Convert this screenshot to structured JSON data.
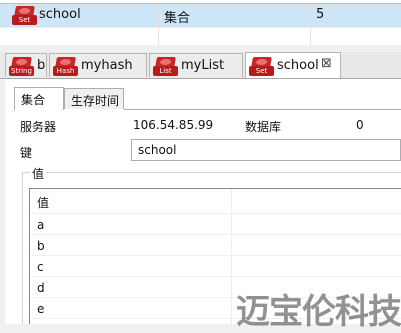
{
  "keys_table": {
    "row": {
      "type_tag": "Set",
      "name": "school",
      "type": "集合",
      "count": "5"
    }
  },
  "tabs": [
    {
      "type_tag": "String",
      "label": "b",
      "active": false
    },
    {
      "type_tag": "Hash",
      "label": "myhash",
      "active": false
    },
    {
      "type_tag": "List",
      "label": "myList",
      "active": false
    },
    {
      "type_tag": "Set",
      "label": "school",
      "active": true
    }
  ],
  "subtabs": [
    "集合",
    "生存时间"
  ],
  "info": {
    "server_label": "服务器",
    "server_value": "106.54.85.99",
    "db_label": "数据库",
    "db_value": "0",
    "key_label": "键",
    "key_value": "school"
  },
  "values_group": {
    "title": "值",
    "column_header": "值",
    "items": [
      "a",
      "b",
      "c",
      "d",
      "e"
    ]
  },
  "watermark": "迈宝伦科技",
  "colors": {
    "selection": "#cde6f7",
    "redis_red": "#c62828"
  }
}
